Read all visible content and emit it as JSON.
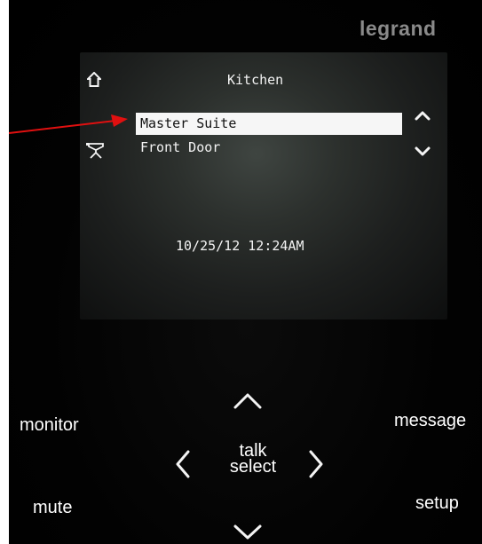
{
  "brand": "legrand",
  "screen": {
    "title": "Kitchen",
    "menu_items": [
      "Master Suite",
      "Front Door"
    ],
    "selected_index": 0,
    "datetime": "10/25/12 12:24AM"
  },
  "buttons": {
    "monitor": "monitor",
    "message": "message",
    "mute": "mute",
    "setup": "setup",
    "talk": "talk",
    "select": "select"
  },
  "icons": {
    "home": "home-icon",
    "camera": "camera-icon",
    "scroll_up": "chevron-up-icon",
    "scroll_down": "chevron-down-icon",
    "nav_up": "chevron-up-icon",
    "nav_down": "chevron-down-icon",
    "nav_left": "chevron-left-icon",
    "nav_right": "chevron-right-icon"
  },
  "colors": {
    "pointer_arrow": "#e01010",
    "brand": "#8a8a8a",
    "selection_bg": "#f6f6f6"
  }
}
